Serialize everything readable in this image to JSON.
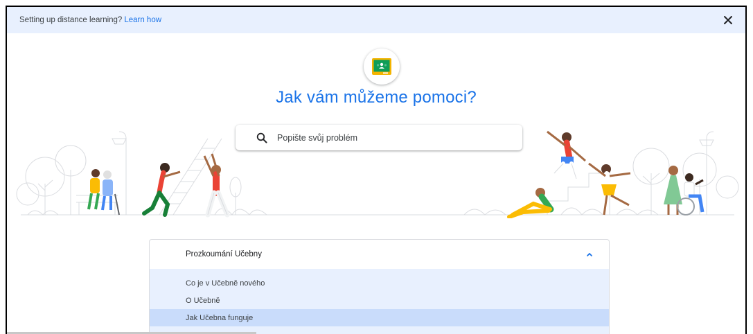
{
  "banner": {
    "text": "Setting up distance learning?",
    "link": "Learn how"
  },
  "logo": {
    "icon": "google-classroom-icon"
  },
  "hero": {
    "title": "Jak vám můžeme pomoci?"
  },
  "search": {
    "placeholder": "Popište svůj problém",
    "value": ""
  },
  "accordion": {
    "title": "Prozkoumání Učebny",
    "expanded": true,
    "items": [
      {
        "label": "Co je v Učebně nového",
        "active": false
      },
      {
        "label": "O Učebně",
        "active": false
      },
      {
        "label": "Jak Učebna funguje",
        "active": true
      }
    ]
  },
  "colors": {
    "accent": "#1a73e8",
    "banner_bg": "#e8f0fe",
    "active_item_bg": "#c9dcfb",
    "classroom_green": "#0f9d58",
    "classroom_yellow": "#f4b400"
  }
}
